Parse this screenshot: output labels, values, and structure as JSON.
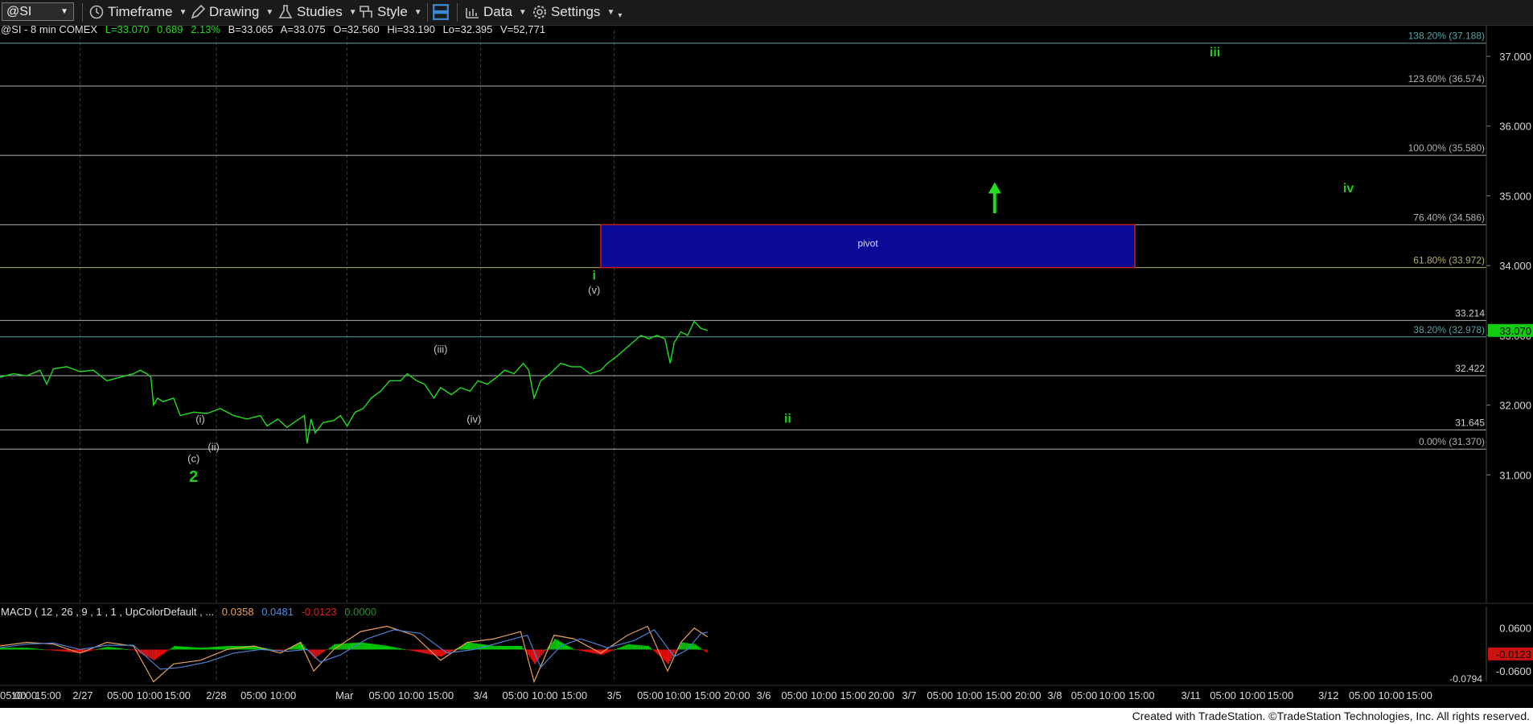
{
  "toolbar": {
    "symbol": "@SI",
    "timeframe": "Timeframe",
    "drawing": "Drawing",
    "studies": "Studies",
    "style": "Style",
    "data": "Data",
    "settings": "Settings"
  },
  "info": {
    "symbol": "@SI - 8 min  COMEX",
    "last": "L=33.070",
    "change": "0.689",
    "pct": "2.13%",
    "bid": "B=33.065",
    "ask": "A=33.075",
    "open": "O=32.560",
    "high": "Hi=33.190",
    "low": "Lo=32.395",
    "volume": "V=52,771"
  },
  "macd": {
    "label": "MACD ( 12 , 26 , 9 , 1 , 1 , UpColorDefault , ...",
    "v1": "0.0358",
    "v2": "0.0481",
    "v3": "-0.0123",
    "v4": "0.0000",
    "axis_ticks": [
      "0.0600",
      "-0.0600"
    ],
    "min_label": "-0.0794",
    "last_badge": "-0.0123",
    "colors": {
      "hist_up": "#00c800",
      "hist_down": "#e01010",
      "macd": "#e6a060",
      "signal": "#4a7fd0",
      "v4": "#2e8b2e"
    }
  },
  "footer": "Created with TradeStation. ©TradeStation Technologies, Inc. All rights reserved.",
  "chart_data": {
    "type": "line",
    "ylim": [
      30.75,
      37.3
    ],
    "price_ticks": [
      "37.000",
      "36.000",
      "35.000",
      "34.000",
      "33.000",
      "32.000",
      "31.000"
    ],
    "last_price_badge": "33.070",
    "fib_levels": [
      {
        "label": "138.20% (37.188)",
        "value": 37.188,
        "color": "#5fa0a0"
      },
      {
        "label": "123.60% (36.574)",
        "value": 36.574,
        "color": "#b0b0b0"
      },
      {
        "label": "100.00% (35.580)",
        "value": 35.58,
        "color": "#b0b0b0"
      },
      {
        "label": "76.40% (34.586)",
        "value": 34.586,
        "color": "#b0b0b0"
      },
      {
        "label": "61.80% (33.972)",
        "value": 33.972,
        "color": "#b0b070"
      },
      {
        "label": "38.20% (32.978)",
        "value": 32.978,
        "color": "#5fa0a0"
      },
      {
        "label": "0.00% (31.370)",
        "value": 31.37,
        "color": "#b0b0b0"
      }
    ],
    "plain_levels": [
      {
        "label": "33.214",
        "value": 33.214
      },
      {
        "label": "32.422",
        "value": 32.422
      },
      {
        "label": "31.645",
        "value": 31.645
      }
    ],
    "pivot": {
      "label": "pivot",
      "low": 33.972,
      "high": 34.586,
      "start_index": 4.5,
      "end_index": 8.5
    },
    "wave_labels": [
      {
        "text": "(i)",
        "value": 31.75,
        "index": 1.5,
        "color": "#c8c8c8"
      },
      {
        "text": "(ii)",
        "value": 31.35,
        "index": 1.6,
        "color": "#c8c8c8"
      },
      {
        "text": "(c)",
        "value": 31.18,
        "index": 1.45,
        "color": "#c8c8c8"
      },
      {
        "text": "2",
        "value": 30.9,
        "index": 1.45,
        "color": "#22cc22"
      },
      {
        "text": "(iii)",
        "value": 32.75,
        "index": 3.3,
        "color": "#c8c8c8"
      },
      {
        "text": "(iv)",
        "value": 31.75,
        "index": 3.55,
        "color": "#c8c8c8"
      },
      {
        "text": "i",
        "value": 33.8,
        "index": 4.45,
        "color": "#22cc22"
      },
      {
        "text": "(v)",
        "value": 33.6,
        "index": 4.45,
        "color": "#c8c8c8"
      },
      {
        "text": "ii",
        "value": 31.75,
        "index": 5.9,
        "color": "#22cc22"
      },
      {
        "text": "iii",
        "value": 37.0,
        "index": 9.1,
        "color": "#22cc22"
      },
      {
        "text": "iv",
        "value": 35.05,
        "index": 10.1,
        "color": "#22cc22"
      }
    ],
    "arrow": {
      "index": 7.45,
      "from": 34.75,
      "to": 35.15,
      "color": "#22dd22"
    },
    "x_axis": {
      "labels": [
        {
          "text": "05:00",
          "pos": 0.0
        },
        {
          "text": "10:00",
          "pos": 0.18
        },
        {
          "text": "15:00",
          "pos": 0.36
        },
        {
          "text": "2/27",
          "pos": 0.62
        },
        {
          "text": "05:00",
          "pos": 0.9
        },
        {
          "text": "10:00",
          "pos": 1.12
        },
        {
          "text": "15:00",
          "pos": 1.33
        },
        {
          "text": "2/28",
          "pos": 1.62
        },
        {
          "text": "05:00",
          "pos": 1.9
        },
        {
          "text": "10:00",
          "pos": 2.12
        },
        {
          "text": "Mar",
          "pos": 2.58
        },
        {
          "text": "05:00",
          "pos": 2.86
        },
        {
          "text": "10:00",
          "pos": 3.08
        },
        {
          "text": "15:00",
          "pos": 3.3
        },
        {
          "text": "3/4",
          "pos": 3.6
        },
        {
          "text": "05:00",
          "pos": 3.86
        },
        {
          "text": "10:00",
          "pos": 4.08
        },
        {
          "text": "15:00",
          "pos": 4.3
        },
        {
          "text": "3/5",
          "pos": 4.6
        },
        {
          "text": "05:00",
          "pos": 4.87
        },
        {
          "text": "10:00",
          "pos": 5.08
        },
        {
          "text": "15:00",
          "pos": 5.3
        },
        {
          "text": "20:00",
          "pos": 5.52
        },
        {
          "text": "3/6",
          "pos": 5.72
        },
        {
          "text": "05:00",
          "pos": 5.95
        },
        {
          "text": "10:00",
          "pos": 6.17
        },
        {
          "text": "15:00",
          "pos": 6.39
        },
        {
          "text": "20:00",
          "pos": 6.6
        },
        {
          "text": "3/7",
          "pos": 6.81
        },
        {
          "text": "05:00",
          "pos": 7.04
        },
        {
          "text": "10:00",
          "pos": 7.26
        },
        {
          "text": "15:00",
          "pos": 7.48
        },
        {
          "text": "20:00",
          "pos": 7.7
        },
        {
          "text": "3/8",
          "pos": 7.9
        },
        {
          "text": "05:00",
          "pos": 8.12
        },
        {
          "text": "10:00",
          "pos": 8.33
        },
        {
          "text": "15:00",
          "pos": 8.55
        },
        {
          "text": "3/11",
          "pos": 8.92
        },
        {
          "text": "05:00",
          "pos": 9.16
        },
        {
          "text": "10:00",
          "pos": 9.38
        },
        {
          "text": "15:00",
          "pos": 9.59
        },
        {
          "text": "3/12",
          "pos": 9.95
        },
        {
          "text": "05:00",
          "pos": 10.2
        },
        {
          "text": "10:00",
          "pos": 10.42
        },
        {
          "text": "15:00",
          "pos": 10.63
        }
      ],
      "day_dividers": [
        0.6,
        1.62,
        2.6,
        3.6,
        4.6
      ]
    },
    "price_path": [
      [
        0.0,
        32.4
      ],
      [
        0.1,
        32.45
      ],
      [
        0.2,
        32.42
      ],
      [
        0.3,
        32.5
      ],
      [
        0.35,
        32.3
      ],
      [
        0.4,
        32.52
      ],
      [
        0.5,
        32.55
      ],
      [
        0.6,
        32.48
      ],
      [
        0.7,
        32.5
      ],
      [
        0.8,
        32.35
      ],
      [
        0.9,
        32.4
      ],
      [
        1.0,
        32.45
      ],
      [
        1.05,
        32.5
      ],
      [
        1.1,
        32.45
      ],
      [
        1.13,
        32.4
      ],
      [
        1.15,
        32.0
      ],
      [
        1.18,
        32.1
      ],
      [
        1.22,
        32.05
      ],
      [
        1.3,
        32.1
      ],
      [
        1.35,
        31.85
      ],
      [
        1.45,
        31.9
      ],
      [
        1.55,
        31.88
      ],
      [
        1.65,
        31.95
      ],
      [
        1.75,
        31.85
      ],
      [
        1.85,
        31.8
      ],
      [
        1.95,
        31.85
      ],
      [
        2.0,
        31.7
      ],
      [
        2.08,
        31.8
      ],
      [
        2.15,
        31.68
      ],
      [
        2.2,
        31.75
      ],
      [
        2.28,
        31.85
      ],
      [
        2.3,
        31.45
      ],
      [
        2.33,
        31.8
      ],
      [
        2.36,
        31.6
      ],
      [
        2.42,
        31.75
      ],
      [
        2.5,
        31.78
      ],
      [
        2.55,
        31.85
      ],
      [
        2.6,
        31.7
      ],
      [
        2.66,
        31.9
      ],
      [
        2.72,
        31.95
      ],
      [
        2.78,
        32.1
      ],
      [
        2.85,
        32.2
      ],
      [
        2.92,
        32.35
      ],
      [
        3.0,
        32.35
      ],
      [
        3.05,
        32.45
      ],
      [
        3.12,
        32.35
      ],
      [
        3.18,
        32.3
      ],
      [
        3.25,
        32.1
      ],
      [
        3.3,
        32.25
      ],
      [
        3.38,
        32.15
      ],
      [
        3.45,
        32.25
      ],
      [
        3.52,
        32.2
      ],
      [
        3.58,
        32.35
      ],
      [
        3.65,
        32.3
      ],
      [
        3.72,
        32.4
      ],
      [
        3.78,
        32.5
      ],
      [
        3.85,
        32.45
      ],
      [
        3.92,
        32.6
      ],
      [
        3.96,
        32.5
      ],
      [
        4.0,
        32.1
      ],
      [
        4.05,
        32.35
      ],
      [
        4.12,
        32.45
      ],
      [
        4.2,
        32.6
      ],
      [
        4.28,
        32.55
      ],
      [
        4.35,
        32.55
      ],
      [
        4.42,
        32.45
      ],
      [
        4.5,
        32.5
      ],
      [
        4.55,
        32.6
      ],
      [
        4.62,
        32.7
      ],
      [
        4.68,
        32.8
      ],
      [
        4.74,
        32.9
      ],
      [
        4.8,
        33.0
      ],
      [
        4.86,
        32.95
      ],
      [
        4.92,
        33.0
      ],
      [
        4.98,
        32.95
      ],
      [
        5.02,
        32.6
      ],
      [
        5.05,
        32.9
      ],
      [
        5.1,
        33.05
      ],
      [
        5.15,
        33.0
      ],
      [
        5.2,
        33.2
      ],
      [
        5.25,
        33.1
      ],
      [
        5.3,
        33.07
      ]
    ],
    "macd_series": {
      "macd": [
        [
          0.0,
          0.01
        ],
        [
          0.2,
          0.02
        ],
        [
          0.4,
          0.015
        ],
        [
          0.6,
          -0.01
        ],
        [
          0.8,
          0.02
        ],
        [
          1.0,
          0.01
        ],
        [
          1.15,
          -0.09
        ],
        [
          1.3,
          -0.04
        ],
        [
          1.5,
          -0.03
        ],
        [
          1.7,
          0.0
        ],
        [
          1.9,
          0.01
        ],
        [
          2.1,
          -0.01
        ],
        [
          2.25,
          0.02
        ],
        [
          2.35,
          -0.06
        ],
        [
          2.5,
          0.0
        ],
        [
          2.7,
          0.05
        ],
        [
          2.9,
          0.065
        ],
        [
          3.1,
          0.04
        ],
        [
          3.3,
          -0.03
        ],
        [
          3.5,
          0.02
        ],
        [
          3.7,
          0.03
        ],
        [
          3.9,
          0.05
        ],
        [
          4.0,
          -0.09
        ],
        [
          4.15,
          0.04
        ],
        [
          4.3,
          0.03
        ],
        [
          4.5,
          -0.01
        ],
        [
          4.7,
          0.04
        ],
        [
          4.85,
          0.065
        ],
        [
          5.0,
          -0.06
        ],
        [
          5.1,
          0.02
        ],
        [
          5.2,
          0.06
        ],
        [
          5.3,
          0.035
        ]
      ],
      "signal": [
        [
          0.0,
          0.005
        ],
        [
          0.2,
          0.015
        ],
        [
          0.4,
          0.018
        ],
        [
          0.6,
          0.0
        ],
        [
          0.8,
          0.012
        ],
        [
          1.0,
          0.012
        ],
        [
          1.2,
          -0.055
        ],
        [
          1.35,
          -0.05
        ],
        [
          1.55,
          -0.035
        ],
        [
          1.75,
          -0.01
        ],
        [
          1.95,
          0.0
        ],
        [
          2.15,
          -0.005
        ],
        [
          2.3,
          0.0
        ],
        [
          2.4,
          -0.035
        ],
        [
          2.55,
          -0.015
        ],
        [
          2.75,
          0.03
        ],
        [
          2.95,
          0.055
        ],
        [
          3.15,
          0.045
        ],
        [
          3.35,
          -0.01
        ],
        [
          3.55,
          0.0
        ],
        [
          3.75,
          0.02
        ],
        [
          3.95,
          0.04
        ],
        [
          4.05,
          -0.05
        ],
        [
          4.2,
          0.01
        ],
        [
          4.35,
          0.03
        ],
        [
          4.55,
          0.005
        ],
        [
          4.75,
          0.025
        ],
        [
          4.9,
          0.055
        ],
        [
          5.05,
          -0.02
        ],
        [
          5.15,
          0.0
        ],
        [
          5.25,
          0.045
        ],
        [
          5.3,
          0.048
        ]
      ],
      "hist": [
        [
          0.0,
          0.005
        ],
        [
          0.2,
          0.005
        ],
        [
          0.4,
          -0.003
        ],
        [
          0.6,
          -0.01
        ],
        [
          0.8,
          0.008
        ],
        [
          1.0,
          -0.002
        ],
        [
          1.15,
          -0.03
        ],
        [
          1.3,
          0.01
        ],
        [
          1.5,
          0.005
        ],
        [
          1.7,
          0.01
        ],
        [
          1.9,
          0.01
        ],
        [
          2.1,
          -0.005
        ],
        [
          2.25,
          0.02
        ],
        [
          2.35,
          -0.025
        ],
        [
          2.5,
          0.015
        ],
        [
          2.7,
          0.02
        ],
        [
          2.9,
          0.01
        ],
        [
          3.1,
          -0.005
        ],
        [
          3.3,
          -0.02
        ],
        [
          3.5,
          0.02
        ],
        [
          3.7,
          0.01
        ],
        [
          3.9,
          0.01
        ],
        [
          4.0,
          -0.04
        ],
        [
          4.15,
          0.03
        ],
        [
          4.3,
          0.0
        ],
        [
          4.5,
          -0.015
        ],
        [
          4.7,
          0.015
        ],
        [
          4.85,
          0.01
        ],
        [
          5.0,
          -0.04
        ],
        [
          5.1,
          0.02
        ],
        [
          5.2,
          0.015
        ],
        [
          5.3,
          -0.012
        ]
      ]
    }
  }
}
